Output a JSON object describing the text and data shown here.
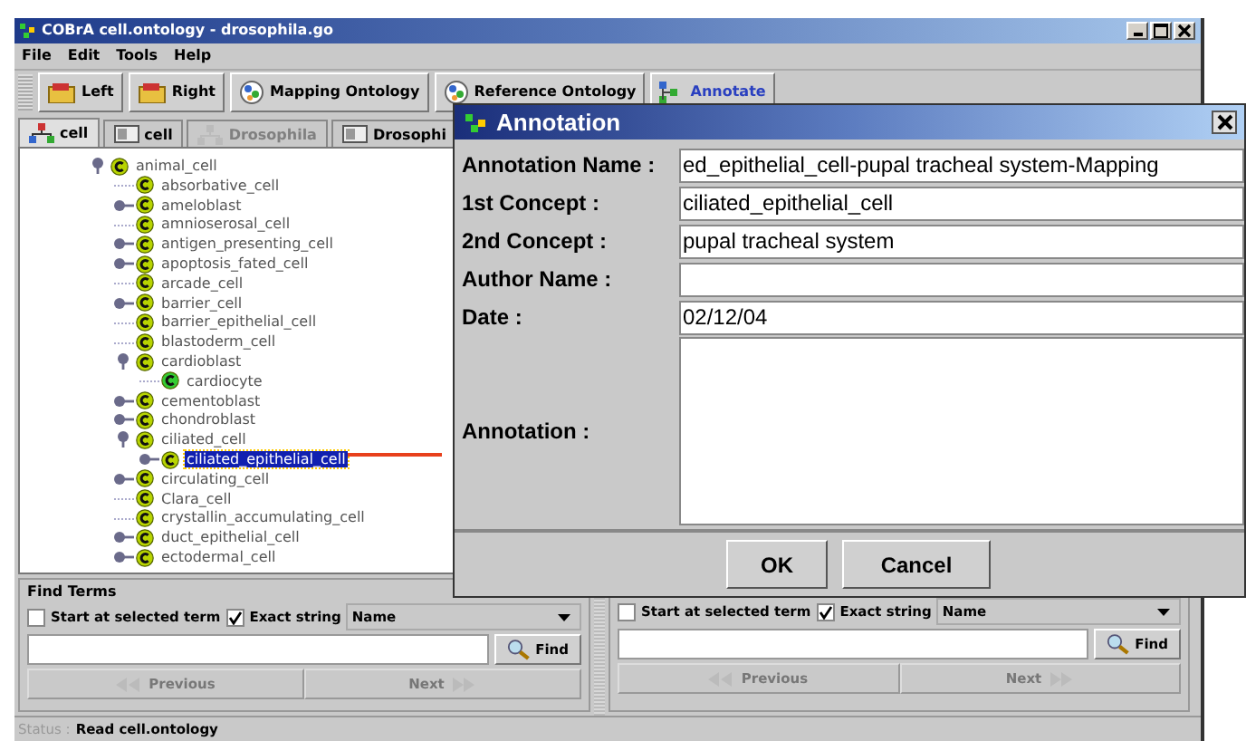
{
  "window": {
    "title": "COBrA  cell.ontology - drosophila.go"
  },
  "menu": [
    "File",
    "Edit",
    "Tools",
    "Help"
  ],
  "toolbar": [
    {
      "label": "Left",
      "kind": "folder"
    },
    {
      "label": "Right",
      "kind": "folder"
    },
    {
      "label": "Mapping Ontology",
      "kind": "globe"
    },
    {
      "label": "Reference Ontology",
      "kind": "globe"
    },
    {
      "label": "Annotate",
      "kind": "nodes"
    }
  ],
  "tabs": [
    {
      "label": "cell",
      "kind": "tree",
      "selected": true,
      "disabled": false
    },
    {
      "label": "cell",
      "kind": "window",
      "selected": false,
      "disabled": false
    },
    {
      "label": "Drosophila",
      "kind": "tree",
      "selected": false,
      "disabled": true
    },
    {
      "label": "Drosophi",
      "kind": "window",
      "selected": false,
      "disabled": false
    }
  ],
  "tree": [
    {
      "label": "animal_cell",
      "kind": "branch",
      "expanded": true,
      "selected": false,
      "children": [
        {
          "label": "absorbative_cell",
          "kind": "leaf",
          "selected": false
        },
        {
          "label": "ameloblast",
          "kind": "branch",
          "expanded": false,
          "selected": false
        },
        {
          "label": "amnioserosal_cell",
          "kind": "leaf",
          "selected": false
        },
        {
          "label": "antigen_presenting_cell",
          "kind": "branch",
          "expanded": false,
          "selected": false
        },
        {
          "label": "apoptosis_fated_cell",
          "kind": "branch",
          "expanded": false,
          "selected": false
        },
        {
          "label": "arcade_cell",
          "kind": "leaf",
          "selected": false
        },
        {
          "label": "barrier_cell",
          "kind": "branch",
          "expanded": false,
          "selected": false
        },
        {
          "label": "barrier_epithelial_cell",
          "kind": "leaf",
          "selected": false
        },
        {
          "label": "blastoderm_cell",
          "kind": "leaf",
          "selected": false
        },
        {
          "label": "cardioblast",
          "kind": "branch",
          "expanded": true,
          "selected": false,
          "children": [
            {
              "label": "cardiocyte",
              "kind": "instance",
              "selected": false
            }
          ]
        },
        {
          "label": "cementoblast",
          "kind": "branch",
          "expanded": false,
          "selected": false
        },
        {
          "label": "chondroblast",
          "kind": "branch",
          "expanded": false,
          "selected": false
        },
        {
          "label": "ciliated_cell",
          "kind": "branch",
          "expanded": true,
          "selected": false,
          "children": [
            {
              "label": "ciliated_epithelial_cell",
              "kind": "branch",
              "expanded": false,
              "selected": true
            }
          ]
        },
        {
          "label": "circulating_cell",
          "kind": "branch",
          "expanded": false,
          "selected": false
        },
        {
          "label": "Clara_cell",
          "kind": "leaf",
          "selected": false
        },
        {
          "label": "crystallin_accumulating_cell",
          "kind": "leaf",
          "selected": false
        },
        {
          "label": "duct_epithelial_cell",
          "kind": "branch",
          "expanded": false,
          "selected": false
        },
        {
          "label": "ectodermal_cell",
          "kind": "branch",
          "expanded": false,
          "selected": false
        }
      ]
    }
  ],
  "find_panels": [
    {
      "title": "Find Terms",
      "start_at_selected": {
        "label": "Start at selected term",
        "checked": false
      },
      "exact": {
        "label": "Exact string",
        "checked": true
      },
      "search_by": "Name",
      "find": "Find",
      "previous": "Previous",
      "next": "Next"
    },
    {
      "start_at_selected": {
        "label": "Start at selected term",
        "checked": false
      },
      "exact": {
        "label": "Exact string",
        "checked": true
      },
      "search_by": "Name",
      "find": "Find",
      "previous": "Previous",
      "next": "Next"
    }
  ],
  "status": {
    "label": "Status :",
    "text": "Read cell.ontology"
  },
  "dialog": {
    "title": "Annotation",
    "fields": [
      {
        "label": "Annotation Name :",
        "value": "ed_epithelial_cell-pupal tracheal system-Mapping",
        "kind": "line"
      },
      {
        "label": "1st Concept :",
        "value": "ciliated_epithelial_cell",
        "kind": "line"
      },
      {
        "label": "2nd Concept :",
        "value": "pupal tracheal system",
        "kind": "line"
      },
      {
        "label": "Author Name :",
        "kind": "line"
      },
      {
        "label": "Date :",
        "value": "02/12/04",
        "kind": "line"
      },
      {
        "label": "Annotation :",
        "kind": "area"
      }
    ],
    "buttons": [
      "OK",
      "Cancel"
    ]
  }
}
